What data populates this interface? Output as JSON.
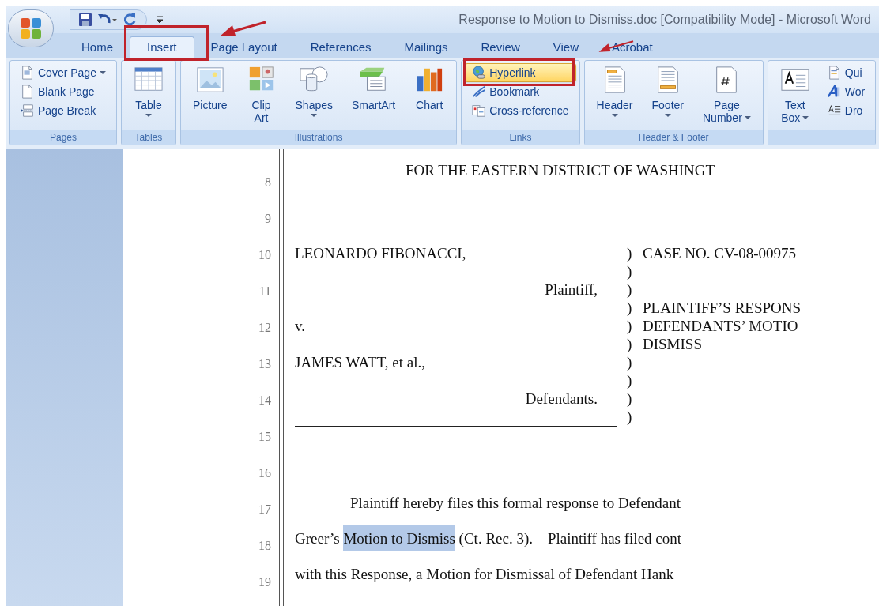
{
  "window": {
    "title": "Response to Motion to Dismiss.doc [Compatibility Mode] - Microsoft Word"
  },
  "tabs": [
    {
      "label": "Home",
      "selected": false
    },
    {
      "label": "Insert",
      "selected": true
    },
    {
      "label": "Page Layout",
      "selected": false
    },
    {
      "label": "References",
      "selected": false
    },
    {
      "label": "Mailings",
      "selected": false
    },
    {
      "label": "Review",
      "selected": false
    },
    {
      "label": "View",
      "selected": false
    },
    {
      "label": "Acrobat",
      "selected": false
    }
  ],
  "ribbon": {
    "groups": [
      {
        "label": "Pages",
        "buttons": [
          {
            "kind": "small",
            "label_lines": [
              "Cover Page"
            ],
            "dropdown": true,
            "highlighted": false
          },
          {
            "kind": "small",
            "label_lines": [
              "Blank Page"
            ],
            "dropdown": false,
            "highlighted": false
          },
          {
            "kind": "small",
            "label_lines": [
              "Page Break"
            ],
            "dropdown": false,
            "highlighted": false
          }
        ]
      },
      {
        "label": "Tables",
        "buttons": [
          {
            "kind": "large",
            "label_lines": [
              "Table"
            ],
            "dropdown": true,
            "highlighted": false
          }
        ]
      },
      {
        "label": "Illustrations",
        "buttons": [
          {
            "kind": "large",
            "label_lines": [
              "Picture"
            ],
            "dropdown": false,
            "highlighted": false
          },
          {
            "kind": "large",
            "label_lines": [
              "Clip",
              "Art"
            ],
            "dropdown": false,
            "highlighted": false
          },
          {
            "kind": "large",
            "label_lines": [
              "Shapes"
            ],
            "dropdown": true,
            "highlighted": false
          },
          {
            "kind": "large",
            "label_lines": [
              "SmartArt"
            ],
            "dropdown": false,
            "highlighted": false
          },
          {
            "kind": "large",
            "label_lines": [
              "Chart"
            ],
            "dropdown": false,
            "highlighted": false
          }
        ]
      },
      {
        "label": "Links",
        "buttons": [
          {
            "kind": "small",
            "label_lines": [
              "Hyperlink"
            ],
            "dropdown": false,
            "highlighted": true
          },
          {
            "kind": "small",
            "label_lines": [
              "Bookmark"
            ],
            "dropdown": false,
            "highlighted": false
          },
          {
            "kind": "small",
            "label_lines": [
              "Cross-reference"
            ],
            "dropdown": false,
            "highlighted": false
          }
        ]
      },
      {
        "label": "Header & Footer",
        "buttons": [
          {
            "kind": "large",
            "label_lines": [
              "Header"
            ],
            "dropdown": true,
            "highlighted": false
          },
          {
            "kind": "large",
            "label_lines": [
              "Footer"
            ],
            "dropdown": true,
            "highlighted": false
          },
          {
            "kind": "large",
            "label_lines": [
              "Page",
              "Number"
            ],
            "dropdown": true,
            "highlighted": false
          }
        ]
      },
      {
        "buttons": [
          {
            "kind": "large",
            "label_lines": [
              "Text",
              "Box"
            ],
            "dropdown": true,
            "highlighted": false
          },
          {
            "kind": "small",
            "label_lines": [
              "Qui"
            ],
            "dropdown": false,
            "highlighted": false
          },
          {
            "kind": "small",
            "label_lines": [
              "Wor"
            ],
            "dropdown": false,
            "highlighted": false
          },
          {
            "kind": "small",
            "label_lines": [
              "Dro"
            ],
            "dropdown": false,
            "highlighted": false
          }
        ]
      }
    ]
  },
  "document": {
    "line_numbers": [
      "8",
      "9",
      "10",
      "11",
      "12",
      "13",
      "14",
      "15",
      "16",
      "17",
      "18",
      "19"
    ],
    "court_heading": "FOR THE EASTERN DISTRICT OF WASHINGT",
    "caption": [
      {
        "left": "LEONARDO FIBONACCI,",
        "kind": "party",
        "paren": ")",
        "right": "CASE NO. CV-08-00975"
      },
      {
        "paren": ")"
      },
      {
        "left": "Plaintiff,",
        "kind": "role",
        "paren": ")"
      },
      {
        "paren": ")",
        "right": "PLAINTIFF’S RESPONS"
      },
      {
        "left": "v.",
        "kind": "party",
        "paren": ")",
        "right": "DEFENDANTS’ MOTIO"
      },
      {
        "paren": ")",
        "right": "DISMISS"
      },
      {
        "left": "JAMES WATT, et al.,",
        "kind": "party",
        "paren": ")"
      },
      {
        "paren": ")"
      },
      {
        "left": "Defendants.",
        "kind": "role",
        "paren": ")"
      },
      {
        "paren": ")"
      }
    ],
    "body": [
      {
        "indent": true,
        "segments": [
          {
            "text": "Plaintiff hereby files this formal response to Defendant",
            "selected": false
          }
        ]
      },
      {
        "indent": false,
        "segments": [
          {
            "text": "Greer’s ",
            "selected": false
          },
          {
            "text": "Motion to Dismiss",
            "selected": true
          },
          {
            "text": " (Ct. Rec. 3).    Plaintiff has filed cont",
            "selected": false
          }
        ]
      },
      {
        "indent": false,
        "segments": [
          {
            "text": "with this Response, a Motion for Dismissal of Defendant Hank",
            "selected": false
          }
        ]
      }
    ]
  }
}
